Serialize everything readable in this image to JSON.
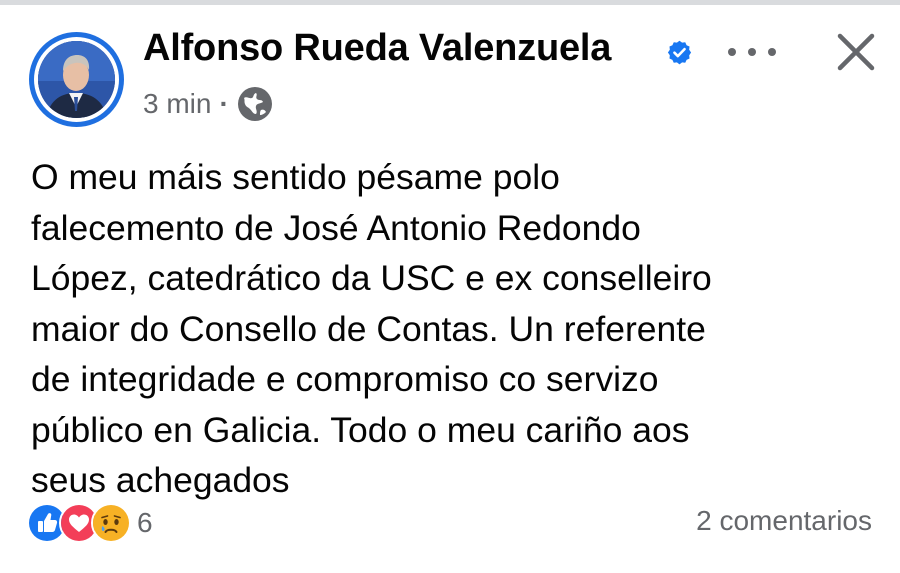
{
  "post": {
    "author": {
      "name": "Alfonso Rueda Valenzuela",
      "verified": true,
      "avatar": "profile-photo"
    },
    "time": "3 min",
    "separator": "·",
    "audience_icon": "globe-icon",
    "text": "O meu máis sentido pésame polo\nfalecemento de José Antonio Redondo\nLópez, catedrático da USC e ex conselleiro\nmaior do Consello de Contas. Un referente\nde integridade e compromiso co servizo\npúblico en Galicia. Todo o meu cariño aos\nseus achegados",
    "header_actions": {
      "more_icon": "more-horizontal-icon",
      "close_icon": "close-icon"
    },
    "footer": {
      "reaction_icons": [
        "like-icon",
        "love-icon",
        "sad-icon"
      ],
      "reaction_count": "6",
      "comments": "2 comentarios"
    }
  },
  "colors": {
    "text_primary": "#050505",
    "text_secondary": "#65676b",
    "accent_blue": "#1877f2",
    "avatar_ring": "#1f6fe0",
    "love_red": "#f33e58",
    "sad_yellow": "#f7b125"
  }
}
